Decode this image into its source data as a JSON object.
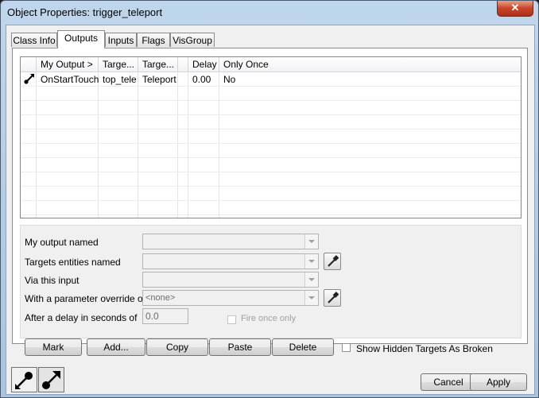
{
  "window": {
    "title": "Object Properties: trigger_teleport",
    "close_glyph": "✕"
  },
  "tabs": [
    {
      "label": "Class Info"
    },
    {
      "label": "Outputs"
    },
    {
      "label": "Inputs"
    },
    {
      "label": "Flags"
    },
    {
      "label": "VisGroup"
    }
  ],
  "outputs_list": {
    "columns": [
      "",
      "My Output  >",
      "Targe...",
      "Targe...",
      "",
      "Delay",
      "Only Once"
    ],
    "rows": [
      {
        "icon": "output-arrow-icon",
        "my_output": "OnStartTouch",
        "target_entity": "top_tele",
        "target_input": "Teleport",
        "delay": "0.00",
        "only_once": "No"
      }
    ]
  },
  "form": {
    "my_output_label": "My output named",
    "targets_label": "Targets entities named",
    "via_input_label": "Via this input",
    "param_label": "With a parameter override of",
    "param_value": "<none>",
    "delay_label": "After a delay in seconds of",
    "delay_value": "0.0",
    "fire_once_label": "Fire once only"
  },
  "buttons": {
    "mark": "Mark",
    "add": "Add...",
    "copy": "Copy",
    "paste": "Paste",
    "delete": "Delete",
    "show_hidden": "Show Hidden Targets As Broken",
    "cancel": "Cancel",
    "apply": "Apply"
  }
}
